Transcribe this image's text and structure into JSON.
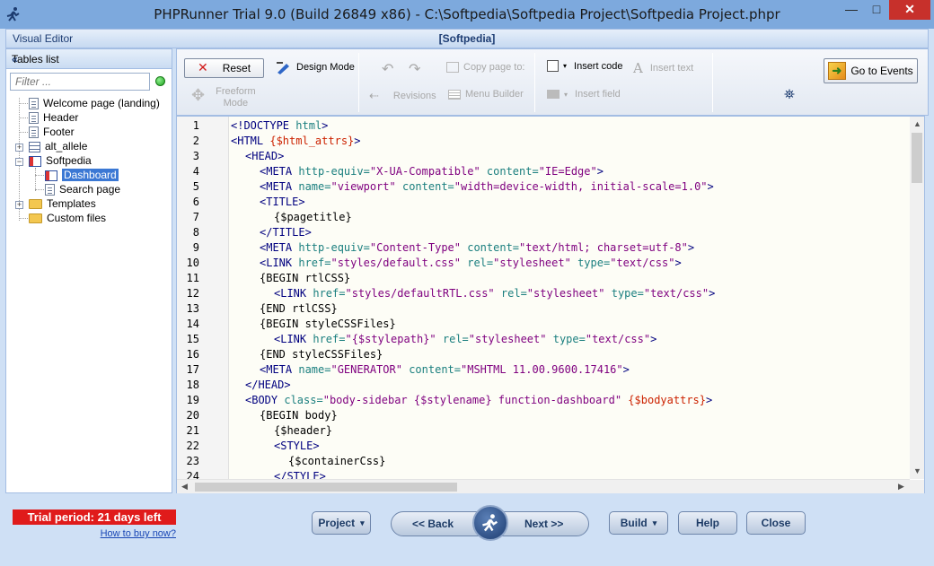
{
  "window": {
    "title": "PHPRunner Trial 9.0 (Build 26849 x86) - C:\\Softpedia\\Softpedia Project\\Softpedia Project.phpr",
    "minimize": "—",
    "maximize": "□",
    "close": "✕"
  },
  "visual_editor": {
    "label": "Visual Editor",
    "page_name": "[Softpedia]"
  },
  "tables_panel": {
    "title": "Tables list",
    "collapse": "«",
    "filter_placeholder": "Filter ...",
    "items": [
      {
        "label": "Welcome page (landing)"
      },
      {
        "label": "Header"
      },
      {
        "label": "Footer"
      },
      {
        "label": "alt_allele"
      },
      {
        "label": "Softpedia"
      },
      {
        "label": "Dashboard"
      },
      {
        "label": "Search page"
      },
      {
        "label": "Templates"
      },
      {
        "label": "Custom files"
      }
    ]
  },
  "toolbar": {
    "reset": "Reset",
    "design_mode": "Design Mode",
    "freeform_mode_1": "Freeform",
    "freeform_mode_2": "Mode",
    "page_to": "Copy page to:",
    "revisions": "Revisions",
    "menu_builder": "Menu Builder",
    "insert_code": "Insert code",
    "insert_text": "Insert text",
    "insert_field": "Insert field",
    "go_to_events": "Go to Events"
  },
  "editor": {
    "line_numbers": [
      "1",
      "2",
      "3",
      "4",
      "5",
      "6",
      "7",
      "8",
      "9",
      "10",
      "11",
      "12",
      "13",
      "14",
      "15",
      "16",
      "17",
      "18",
      "19",
      "20",
      "21",
      "22",
      "23",
      "24"
    ]
  },
  "bottom": {
    "trial": "Trial period: 21 days left",
    "how_to_buy": "How to buy now?",
    "project": "Project",
    "back": "<< Back",
    "next": "Next >>",
    "build": "Build",
    "help": "Help",
    "close": "Close"
  }
}
